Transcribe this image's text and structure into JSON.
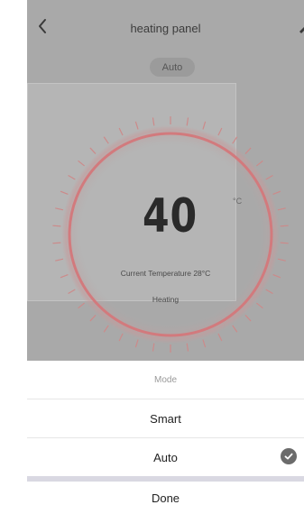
{
  "header": {
    "title": "heating panel"
  },
  "mode_pill": {
    "label": "Auto"
  },
  "thermostat": {
    "set_temperature": "40",
    "unit": "°C",
    "current_temperature": "Current Temperature 28°C",
    "status": "Heating"
  },
  "mode_sheet": {
    "title": "Mode",
    "options": [
      {
        "label": "Smart",
        "selected": false
      },
      {
        "label": "Auto",
        "selected": true
      }
    ],
    "done_label": "Done"
  },
  "colors": {
    "dim_overlay": "#a9a9a9",
    "ring": "#d27a7d",
    "ticks": "#cc8a8a",
    "check": "#6b6b6b",
    "separator": "#d9d8e2"
  },
  "icons": {
    "back": "chevron-left-icon",
    "edit": "pencil-icon",
    "selected": "checkmark-icon"
  }
}
